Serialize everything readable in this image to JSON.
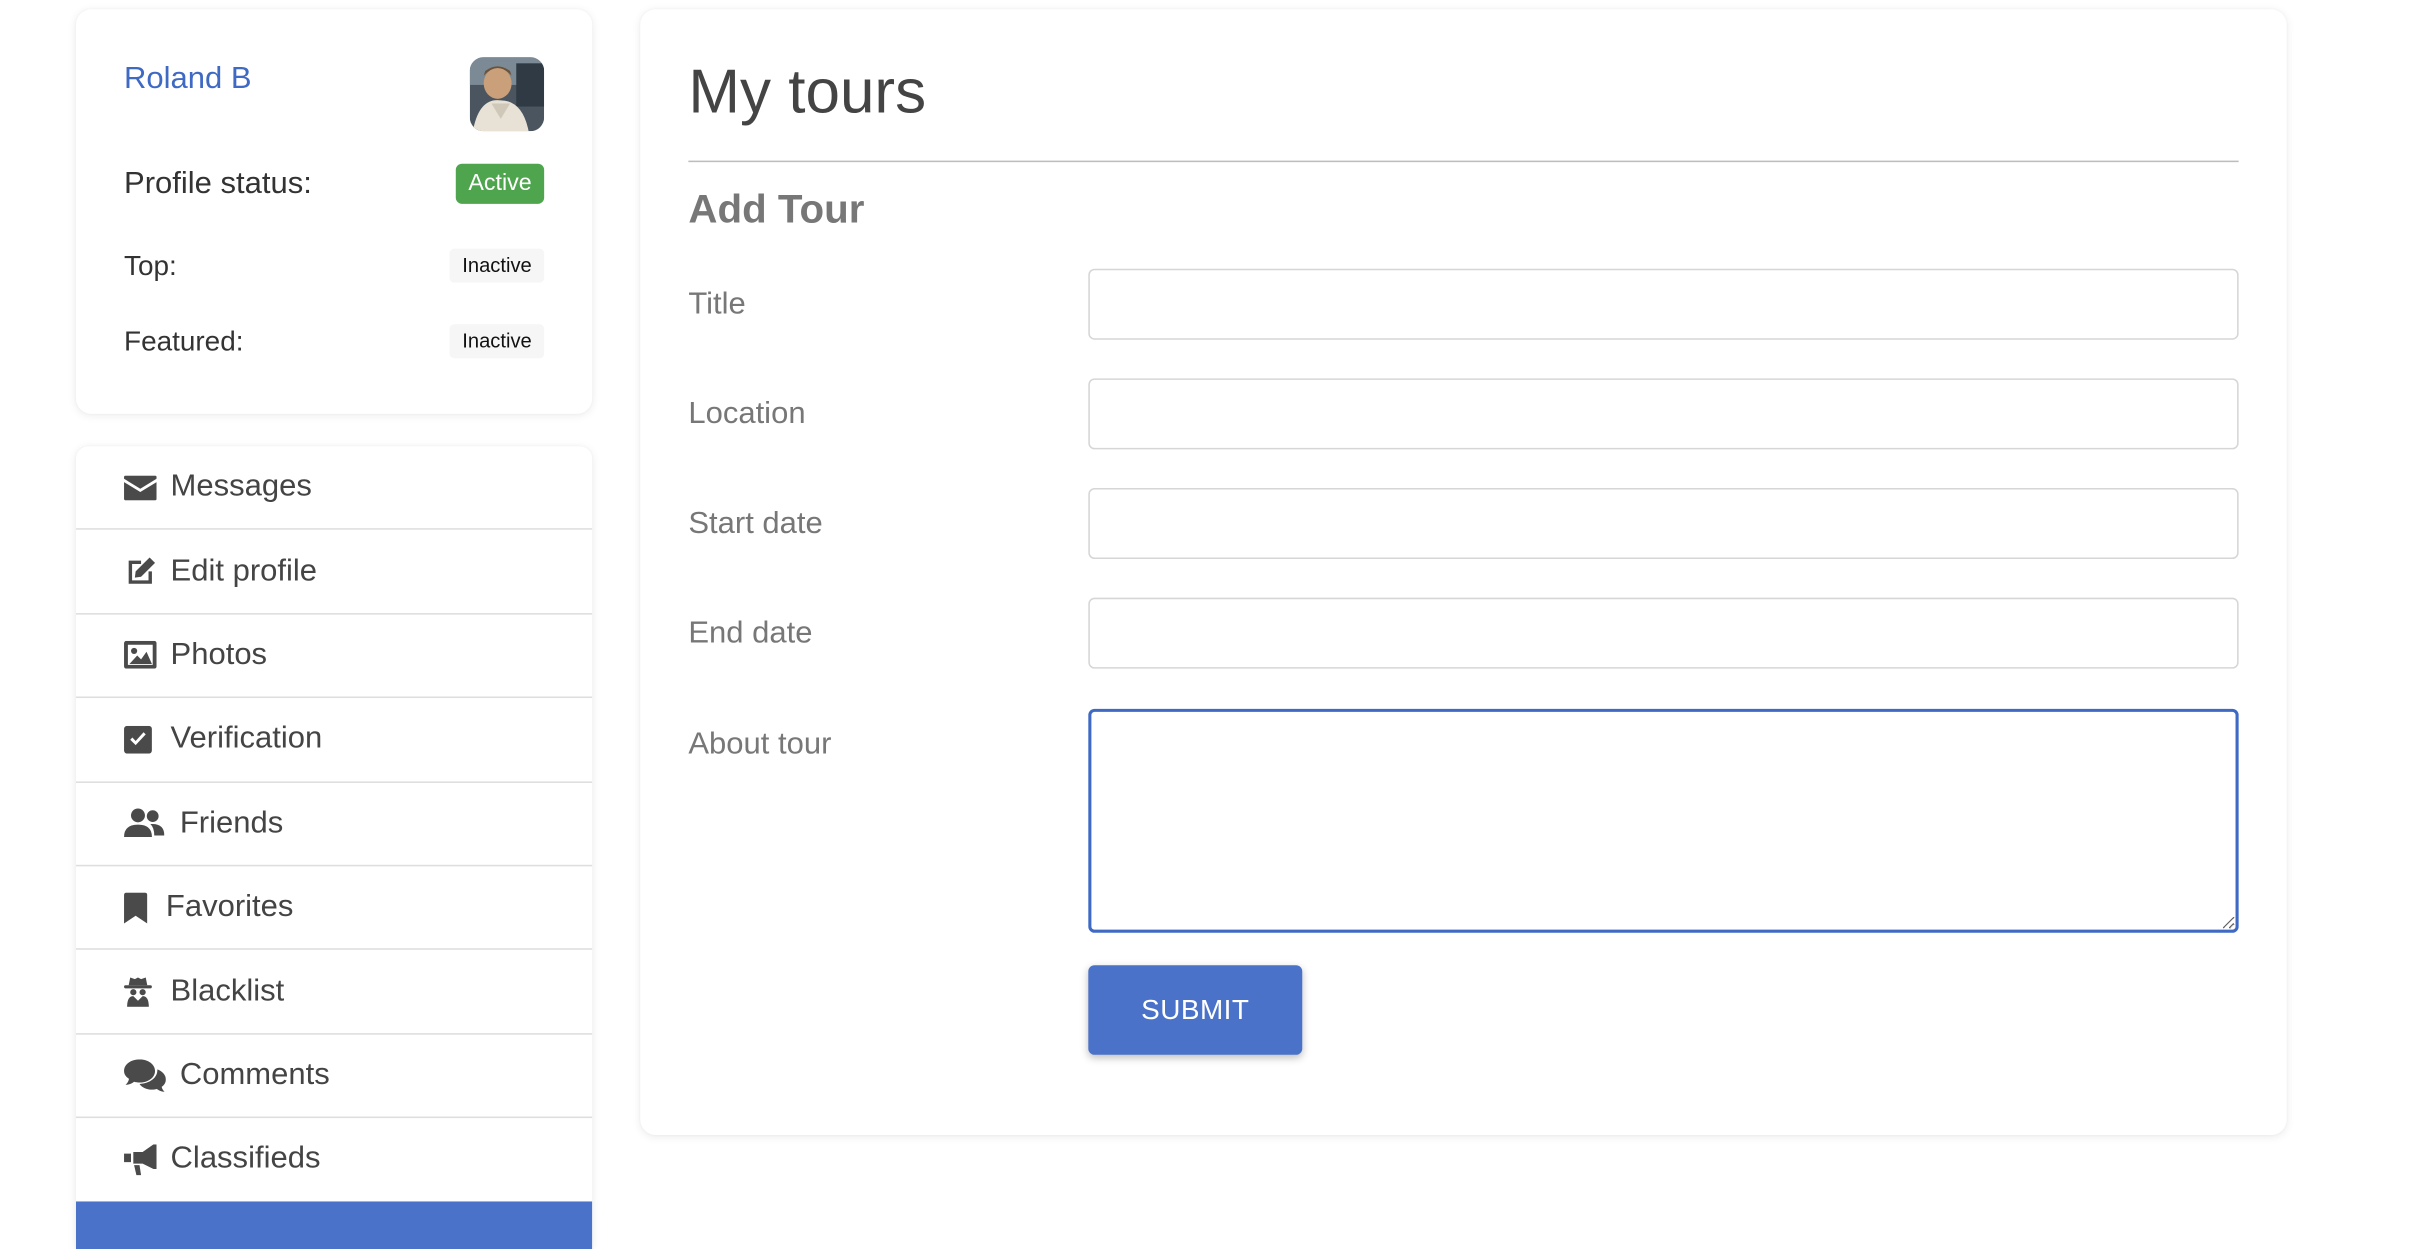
{
  "profile": {
    "name": "Roland B",
    "avatar_icon": "user-photo",
    "status_label": "Profile status:",
    "status_value": "Active",
    "top_label": "Top:",
    "top_value": "Inactive",
    "featured_label": "Featured:",
    "featured_value": "Inactive"
  },
  "menu": {
    "items": [
      {
        "label": "Messages",
        "icon": "envelope-icon"
      },
      {
        "label": "Edit profile",
        "icon": "edit-icon"
      },
      {
        "label": "Photos",
        "icon": "image-icon"
      },
      {
        "label": "Verification",
        "icon": "checkbox-icon"
      },
      {
        "label": "Friends",
        "icon": "users-icon"
      },
      {
        "label": "Favorites",
        "icon": "bookmark-icon"
      },
      {
        "label": "Blacklist",
        "icon": "spy-icon"
      },
      {
        "label": "Comments",
        "icon": "comments-icon"
      },
      {
        "label": "Classifieds",
        "icon": "megaphone-icon"
      }
    ]
  },
  "main": {
    "title": "My tours",
    "section_title": "Add Tour",
    "fields": {
      "title_label": "Title",
      "title_value": "",
      "location_label": "Location",
      "location_value": "",
      "start_label": "Start date",
      "start_value": "",
      "end_label": "End date",
      "end_value": "",
      "about_label": "About tour",
      "about_value": ""
    },
    "submit_label": "SUBMIT"
  },
  "colors": {
    "accent": "#4a72c9",
    "link": "#3f6ac4",
    "active_badge": "#4ea54e"
  }
}
